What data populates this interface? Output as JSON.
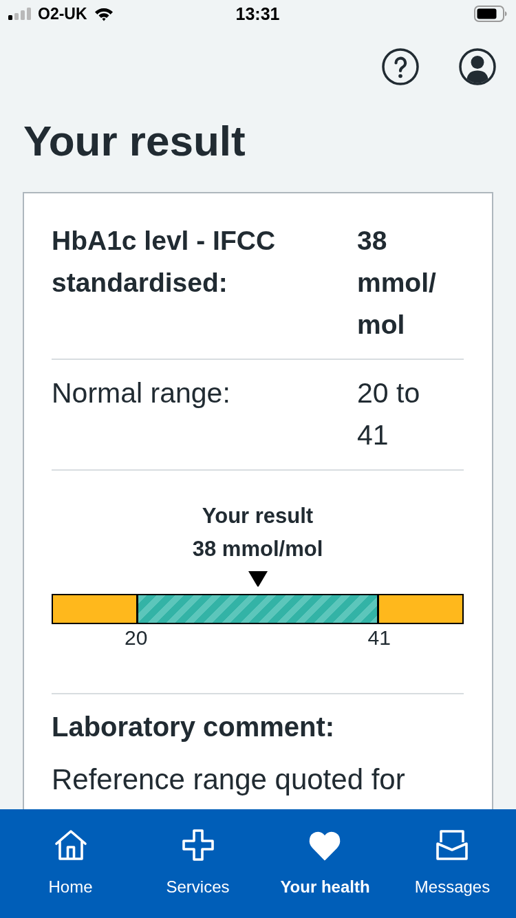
{
  "status_bar": {
    "carrier": "O2-UK",
    "time": "13:31"
  },
  "header": {
    "title": "Your result"
  },
  "result_card": {
    "rows": [
      {
        "kind": "result",
        "label": "HbA1c levl - IFCC standardised:",
        "value": "38 mmol/mol"
      },
      {
        "kind": "range",
        "label": "Normal range:",
        "value": "20 to 41"
      }
    ],
    "range_chart": {
      "title": "Your result",
      "reading": "38 mmol/mol",
      "marker": {
        "level": 0.5
      },
      "segments": [
        {
          "kind": "outside",
          "color": "#ffb81c"
        },
        {
          "kind": "normal",
          "color": "#33b3a6"
        },
        {
          "kind": "outside",
          "color": "#ffb81c"
        }
      ],
      "ticks": [
        "20",
        "41"
      ]
    },
    "comment": {
      "heading": "Laboratory comment:",
      "text": "Reference range quoted for"
    }
  },
  "tab_bar": {
    "items": [
      {
        "kind": "home",
        "label": "Home",
        "selected": false
      },
      {
        "kind": "services",
        "label": "Services",
        "selected": false
      },
      {
        "kind": "health",
        "label": "Your health",
        "selected": true
      },
      {
        "kind": "messages",
        "label": "Messages",
        "selected": false
      }
    ]
  }
}
